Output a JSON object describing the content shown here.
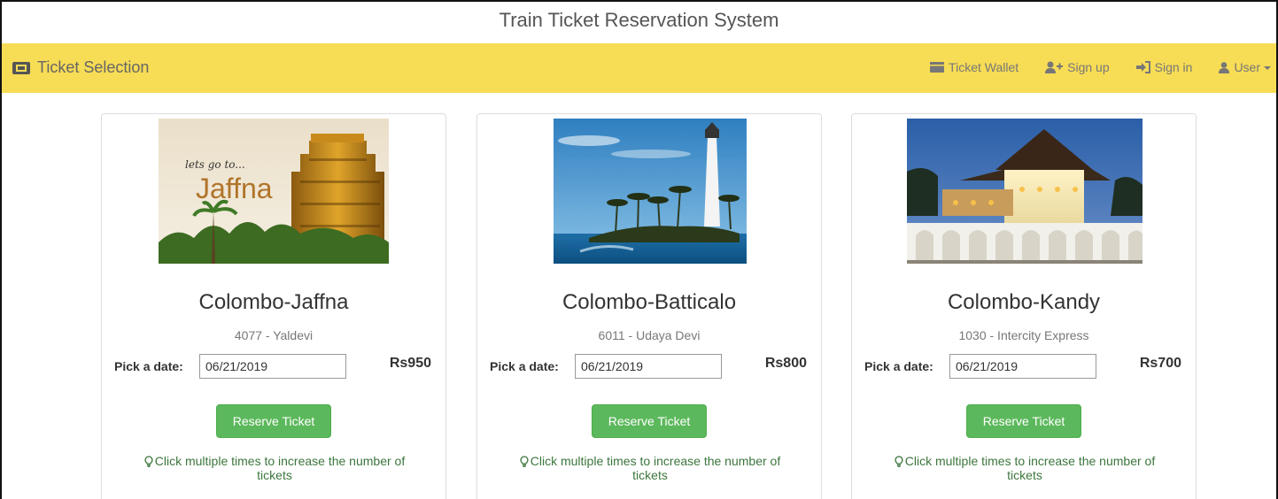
{
  "header": {
    "title": "Train Ticket Reservation System"
  },
  "navbar": {
    "brand": "Ticket Selection",
    "items": [
      {
        "label": "Ticket Wallet",
        "icon": "wallet-icon"
      },
      {
        "label": "Sign up",
        "icon": "user-plus-icon"
      },
      {
        "label": "Sign in",
        "icon": "sign-in-icon"
      },
      {
        "label": "User",
        "icon": "user-icon"
      }
    ]
  },
  "cards": [
    {
      "route": "Colombo-Jaffna",
      "train": "4077 - Yaldevi",
      "date_label": "Pick a date:",
      "date": "06/21/2019",
      "price": "Rs950",
      "button": "Reserve Ticket",
      "hint": "Click multiple times to increase the number of tickets",
      "image": "Jaffna temple photo",
      "photo_text": {
        "line1": "lets go to...",
        "line2": "Jaffna"
      }
    },
    {
      "route": "Colombo-Batticalo",
      "train": "6011 - Udaya Devi",
      "date_label": "Pick a date:",
      "date": "06/21/2019",
      "price": "Rs800",
      "button": "Reserve Ticket",
      "hint": "Click multiple times to increase the number of tickets",
      "image": "Batticaloa lighthouse photo"
    },
    {
      "route": "Colombo-Kandy",
      "train": "1030 - Intercity Express",
      "date_label": "Pick a date:",
      "date": "06/21/2019",
      "price": "Rs700",
      "button": "Reserve Ticket",
      "hint": "Click multiple times to increase the number of tickets",
      "image": "Kandy temple photo"
    }
  ],
  "colors": {
    "navbar": "#f7dc55",
    "button": "#5cb85c",
    "hint": "#3c763d"
  }
}
